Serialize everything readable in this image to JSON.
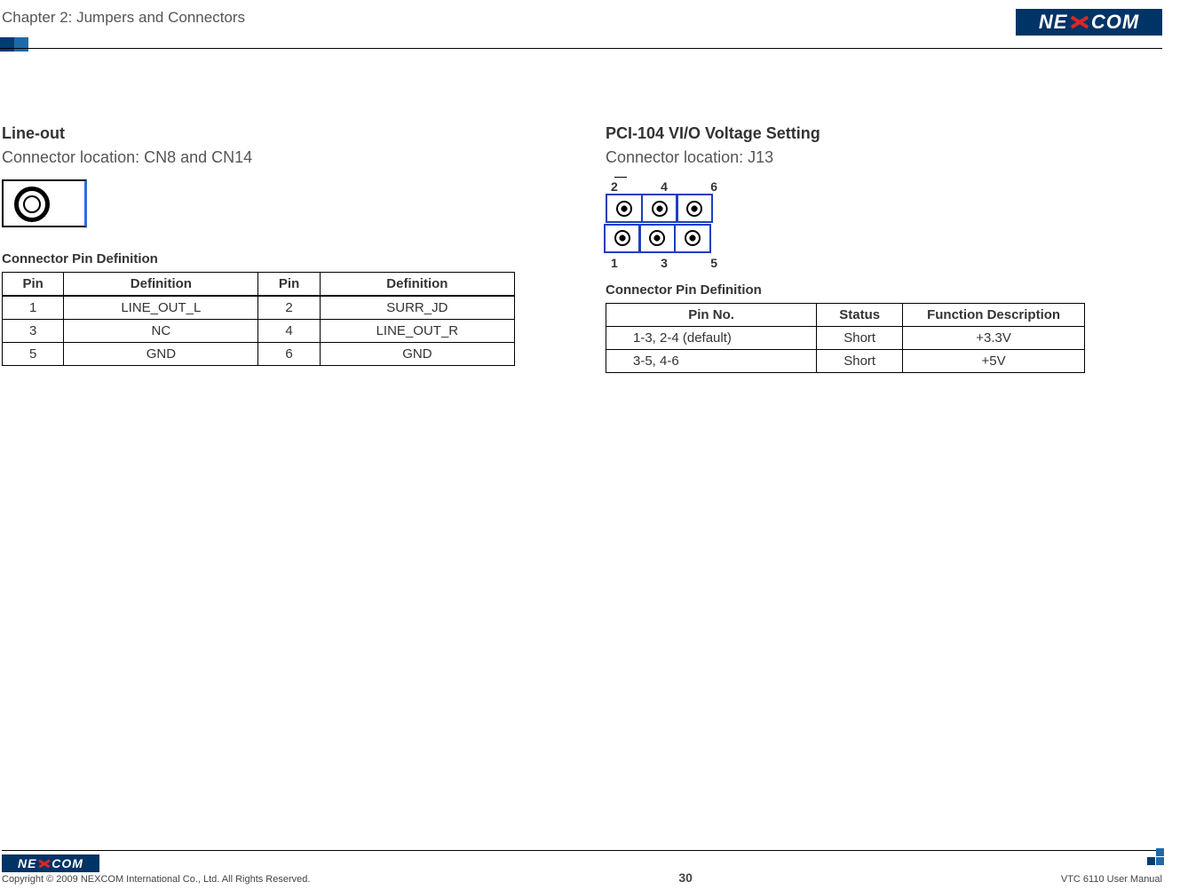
{
  "header": {
    "chapter": "Chapter 2: Jumpers and Connectors",
    "brand": "NEXCOM"
  },
  "left": {
    "title": "Line-out",
    "location": "Connector location: CN8 and CN14",
    "table_label": "Connector Pin Definition",
    "table": {
      "headers": {
        "pin": "Pin",
        "def": "Definition"
      },
      "rows": [
        {
          "p1": "1",
          "d1": "LINE_OUT_L",
          "p2": "2",
          "d2": "SURR_JD"
        },
        {
          "p1": "3",
          "d1": "NC",
          "p2": "4",
          "d2": "LINE_OUT_R"
        },
        {
          "p1": "5",
          "d1": "GND",
          "p2": "6",
          "d2": "GND"
        }
      ]
    }
  },
  "right": {
    "title": "PCI-104 VI/O Voltage Setting",
    "location": "Connector location: J13",
    "pin_labels": {
      "top": [
        "2",
        "4",
        "6"
      ],
      "bottom": [
        "1",
        "3",
        "5"
      ]
    },
    "table_label": "Connector Pin Definition",
    "table": {
      "headers": {
        "pinno": "Pin No.",
        "status": "Status",
        "func": "Function Description"
      },
      "rows": [
        {
          "pinno": "1-3, 2-4 (default)",
          "status": "Short",
          "func": "+3.3V"
        },
        {
          "pinno": "3-5, 4-6",
          "status": "Short",
          "func": "+5V"
        }
      ]
    }
  },
  "footer": {
    "brand": "NEXCOM",
    "copyright": "Copyright © 2009 NEXCOM International Co., Ltd. All Rights Reserved.",
    "page": "30",
    "manual": "VTC 6110 User Manual"
  }
}
